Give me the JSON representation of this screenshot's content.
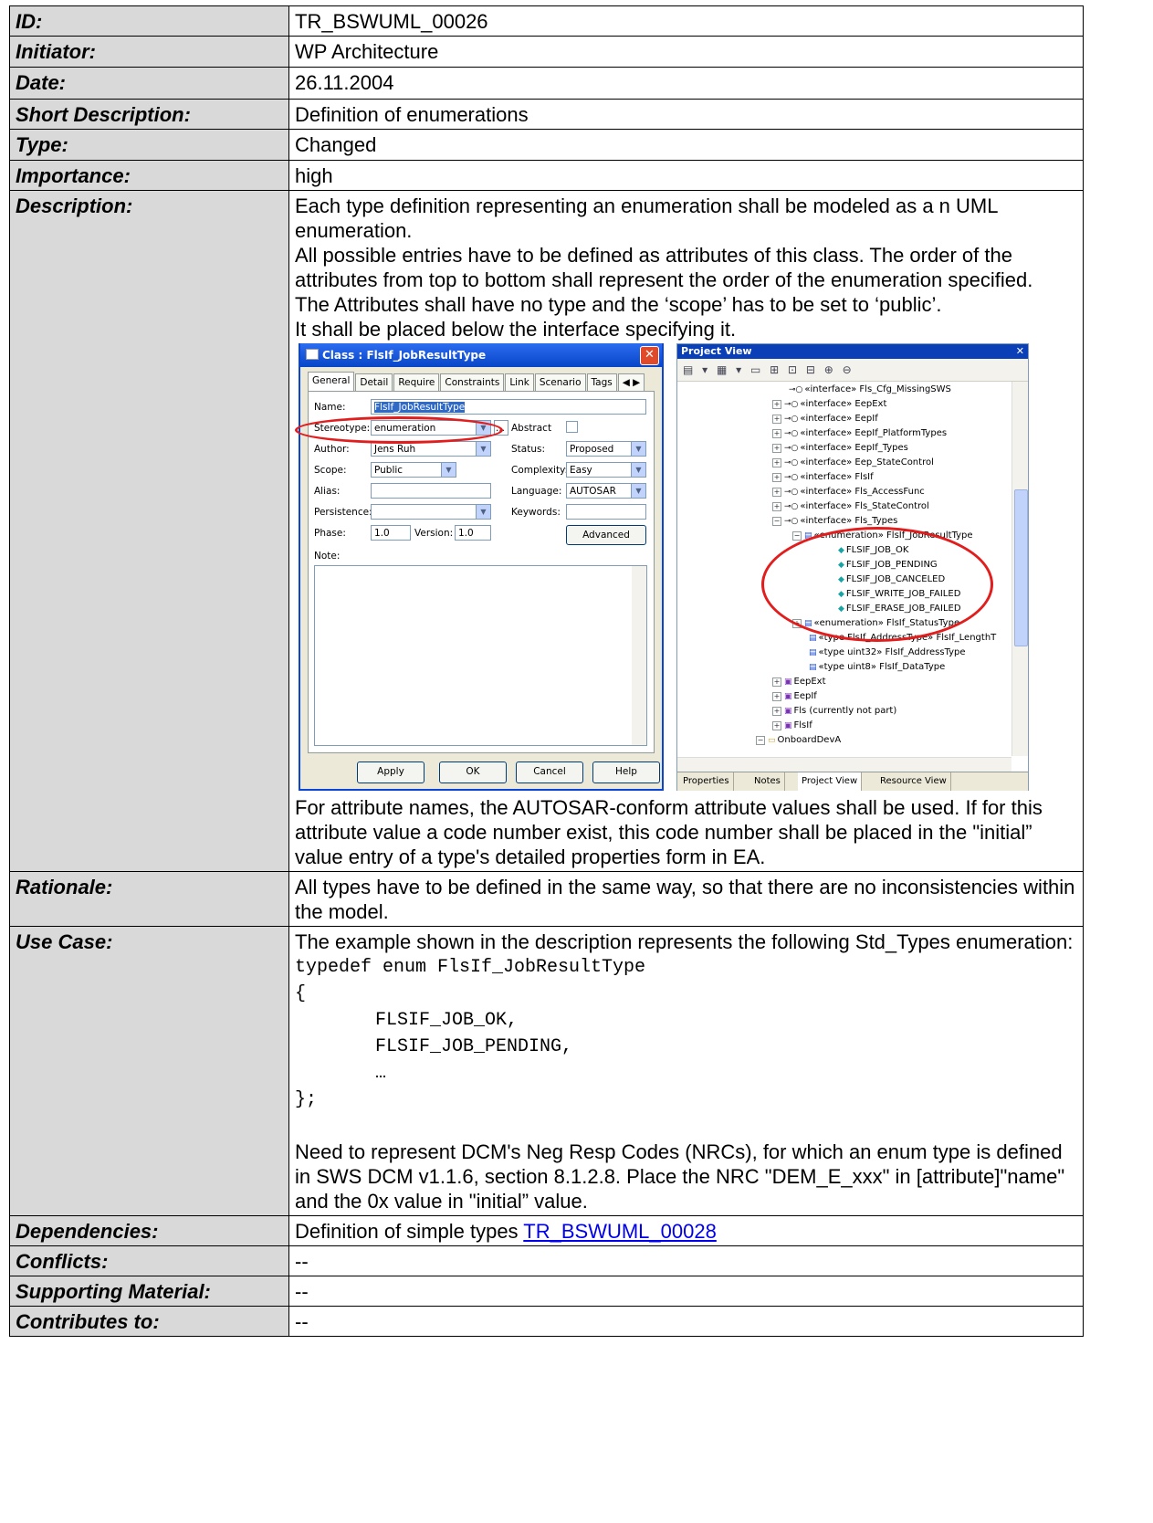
{
  "rows": {
    "id": {
      "label": "ID:",
      "value": "TR_BSWUML_00026"
    },
    "initiator": {
      "label": "Initiator:",
      "value": "WP Architecture"
    },
    "date": {
      "label": "Date:",
      "value": "26.11.2004"
    },
    "short_description": {
      "label": "Short Description:",
      "value": "Definition of enumerations"
    },
    "type": {
      "label": "Type:",
      "value": "Changed"
    },
    "importance": {
      "label": "Importance:",
      "value": "high"
    },
    "description": {
      "label": "Description:",
      "p1": "Each type definition representing an enumeration shall be modeled as a n UML enumeration.",
      "p2": "All possible entries have to be defined as attributes of this class. The order of the attributes from top to bottom shall represent the order of the enumeration specified.",
      "p3": "The Attributes shall have no type and the ‘scope’ has to be set to ‘public’.",
      "p4": "It shall be placed below the interface specifying it.",
      "p5": "For attribute names, the AUTOSAR-conform attribute values shall be used. If for this attribute value a code number exist, this code number shall be placed in the \"initial” value entry of a type's detailed properties form in EA."
    },
    "rationale": {
      "label": "Rationale:",
      "value": "All types have to be defined in the same way, so that there are no inconsistencies within the model."
    },
    "use_case": {
      "label": "Use Case:",
      "intro": "The example shown in the description represents the following Std_Types enumeration:",
      "code": {
        "l1": "typedef enum FlsIf_JobResultType",
        "l2": "{",
        "l3": "FLSIF_JOB_OK,",
        "l4": "FLSIF_JOB_PENDING,",
        "l5": "…",
        "l6": "};"
      },
      "outro": "Need to represent DCM's Neg Resp Codes (NRCs), for which an enum type is defined in SWS DCM v1.1.6, section 8.1.2.8. Place the NRC \"DEM_E_xxx\" in [attribute]\"name\" and the 0x value in \"initial” value."
    },
    "dependencies": {
      "label": "Dependencies:",
      "prefix": "Definition of simple types ",
      "link": "TR_BSWUML_00028"
    },
    "conflicts": {
      "label": "Conflicts:",
      "value": "--"
    },
    "supporting_material": {
      "label": "Supporting Material:",
      "value": "--"
    },
    "contributes_to": {
      "label": "Contributes to:",
      "value": "--"
    }
  },
  "dialog": {
    "title": "Class : FlsIf_JobResultType",
    "close_glyph": "✕",
    "tabs": [
      "General",
      "Detail",
      "Require",
      "Constraints",
      "Link",
      "Scenario",
      "Tags"
    ],
    "tab_arrows": "◀ ▶",
    "fields": {
      "name_label": "Name:",
      "name_value": "FlsIf_JobResultType",
      "stereotype_label": "Stereotype:",
      "stereotype_value": "enumeration",
      "stereotype_more": "...",
      "abstract_label": "Abstract",
      "author_label": "Author:",
      "author_value": "Jens Ruh",
      "status_label": "Status:",
      "status_value": "Proposed",
      "scope_label": "Scope:",
      "scope_value": "Public",
      "complexity_label": "Complexity:",
      "complexity_value": "Easy",
      "alias_label": "Alias:",
      "alias_value": "",
      "language_label": "Language:",
      "language_value": "AUTOSAR",
      "persistence_label": "Persistence:",
      "persistence_value": "",
      "keywords_label": "Keywords:",
      "keywords_value": "",
      "phase_label": "Phase:",
      "phase_value": "1.0",
      "version_label": "Version:",
      "version_value": "1.0",
      "advanced_label": "Advanced",
      "note_label": "Note:"
    },
    "buttons": {
      "apply": "Apply",
      "ok": "OK",
      "cancel": "Cancel",
      "help": "Help"
    }
  },
  "project_view": {
    "title": "Project View",
    "close_glyph": "✕",
    "toolbar_glyphs": "▤ ▾ ▦ ▾ ▭ ⊞ ⊡ ⊟ ⊕ ⊖",
    "tree": [
      "«interface» Fls_Cfg_MissingSWS",
      "«interface» EepExt",
      "«interface» EepIf",
      "«interface» EepIf_PlatformTypes",
      "«interface» EepIf_Types",
      "«interface» Eep_StateControl",
      "«interface» FlsIf",
      "«interface» Fls_AccessFunc",
      "«interface» Fls_StateControl",
      "«interface» Fls_Types",
      "«enumeration» FlsIf_JobResultType",
      "FLSIF_JOB_OK",
      "FLSIF_JOB_PENDING",
      "FLSIF_JOB_CANCELED",
      "FLSIF_WRITE_JOB_FAILED",
      "FLSIF_ERASE_JOB_FAILED",
      "«enumeration» FlsIf_StatusType",
      "«type FlsIf_AddressType» FlsIf_LengthT",
      "«type uint32» FlsIf_AddressType",
      "«type uint8» FlsIf_DataType",
      "EepExt",
      "EepIf",
      "Fls (currently not part)",
      "FlsIf",
      "OnboardDevA"
    ],
    "bottom_tabs": [
      "Properties",
      "Notes",
      "Project View",
      "Resource View"
    ]
  }
}
